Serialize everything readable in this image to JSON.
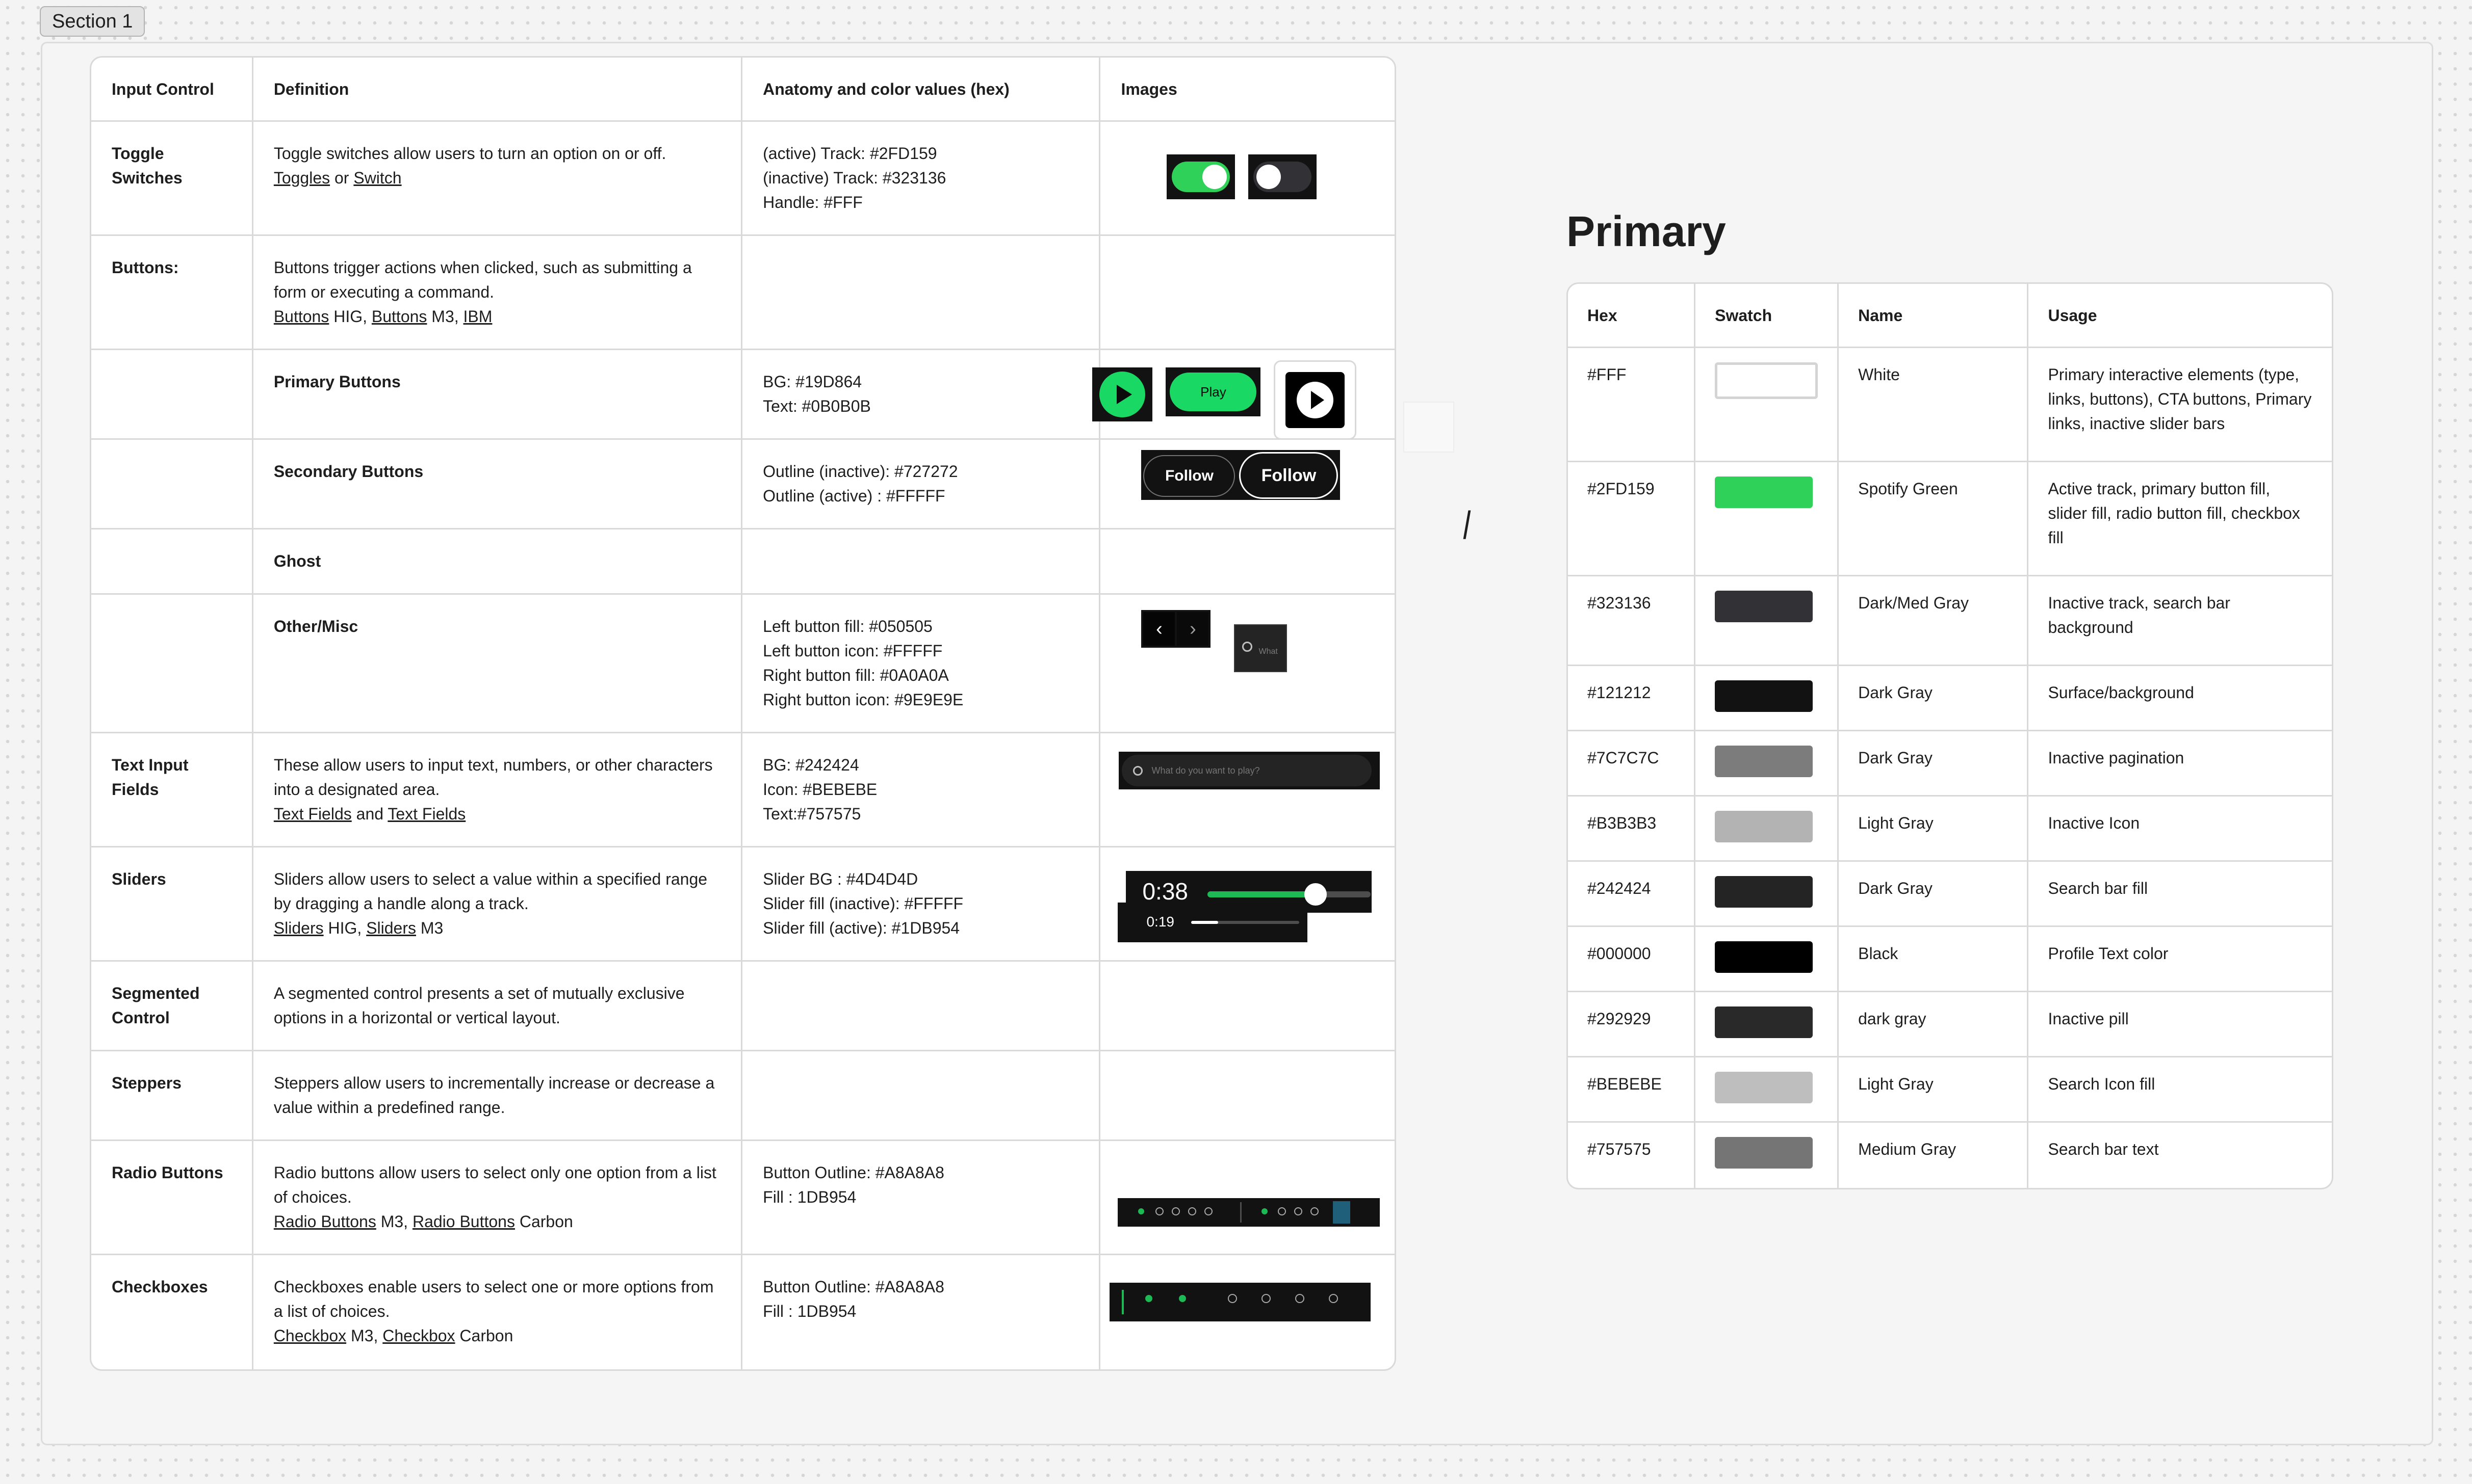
{
  "section_label": "Section 1",
  "left_table": {
    "headers": [
      "Input Control",
      "Definition",
      "Anatomy and color values (hex)",
      "Images"
    ],
    "rows": [
      {
        "control": "Toggle Switches",
        "definition": "Toggle switches allow users to turn an option on or off.",
        "links": [
          "Toggles",
          "or",
          "Switch"
        ],
        "anatomy": [
          "(active) Track: #2FD159",
          "(inactive) Track: #323136",
          "Handle: #FFF"
        ]
      },
      {
        "control": "Buttons:",
        "definition": "Buttons trigger actions when clicked, such as submitting a form or executing a command.",
        "links": [
          "Buttons",
          "HIG,",
          "Buttons",
          "M3,",
          "IBM"
        ]
      },
      {
        "sub": "Primary Buttons",
        "anatomy": [
          "BG: #19D864",
          "Text: #0B0B0B"
        ],
        "play_label": "Play"
      },
      {
        "sub": "Secondary Buttons",
        "anatomy": [
          "Outline (inactive): #727272",
          "Outline (active) : #FFFFF"
        ],
        "follow_label": "Follow"
      },
      {
        "sub": "Ghost"
      },
      {
        "sub": "Other/Misc",
        "anatomy": [
          "Left button fill: #050505",
          "Left button icon: #FFFFF",
          "Right button fill: #0A0A0A",
          "Right button icon: #9E9E9E"
        ],
        "search_hint": "What"
      },
      {
        "control": "Text Input Fields",
        "definition": "These allow users to input text, numbers, or other characters into a designated area.",
        "links": [
          "Text Fields",
          "and",
          "Text Fields"
        ],
        "anatomy": [
          "BG: #242424",
          "Icon: #BEBEBE",
          "Text:#757575"
        ],
        "placeholder": "What do you want to play?"
      },
      {
        "control": "Sliders",
        "definition": "Sliders allow users to select a value within a specified range by dragging a handle along a track.",
        "links": [
          "Sliders",
          "HIG,",
          "Sliders",
          "M3"
        ],
        "anatomy": [
          "Slider BG : #4D4D4D",
          "Slider fill (inactive): #FFFFF",
          "Slider fill (active): #1DB954"
        ],
        "time_big": "0:38",
        "time_small": "0:19"
      },
      {
        "control": "Segmented Control",
        "definition": "A segmented control presents a set of mutually exclusive options in a horizontal or vertical layout."
      },
      {
        "control": "Steppers",
        "definition": "Steppers allow users to incrementally increase or decrease a value within a predefined range."
      },
      {
        "control": "Radio Buttons",
        "definition": "Radio buttons allow users to select only one option from a list of choices.",
        "links": [
          "Radio Buttons",
          "M3,",
          "Radio Buttons",
          "Carbon"
        ],
        "anatomy": [
          "Button Outline: #A8A8A8",
          "Fill : 1DB954"
        ]
      },
      {
        "control": "Checkboxes",
        "definition": "Checkboxes enable users to select one or more options from a list of choices.",
        "links": [
          "Checkbox",
          "M3,",
          "Checkbox",
          "Carbon"
        ],
        "anatomy": [
          "Button Outline: #A8A8A8",
          "Fill : 1DB954"
        ]
      }
    ]
  },
  "primary": {
    "title": "Primary",
    "headers": [
      "Hex",
      "Swatch",
      "Name",
      "Usage"
    ],
    "rows": [
      {
        "hex": "#FFF",
        "color": "#FFFFFF",
        "name": "White",
        "usage": "Primary interactive elements (type, links, buttons), CTA buttons, Primary links, inactive slider bars"
      },
      {
        "hex": "#2FD159",
        "color": "#2FD159",
        "name": "Spotify Green",
        "usage": "Active track, primary button fill, slider fill, radio button fill, checkbox fill"
      },
      {
        "hex": "#323136",
        "color": "#323136",
        "name": "Dark/Med Gray",
        "usage": "Inactive track, search bar background"
      },
      {
        "hex": "#121212",
        "color": "#121212",
        "name": "Dark Gray",
        "usage": "Surface/background"
      },
      {
        "hex": "#7C7C7C",
        "color": "#7C7C7C",
        "name": "Dark Gray",
        "usage": "Inactive pagination"
      },
      {
        "hex": "#B3B3B3",
        "color": "#B3B3B3",
        "name": "Light Gray",
        "usage": "Inactive Icon"
      },
      {
        "hex": "#242424",
        "color": "#242424",
        "name": "Dark Gray",
        "usage": "Search bar fill"
      },
      {
        "hex": "#000000",
        "color": "#000000",
        "name": "Black",
        "usage": "Profile Text color"
      },
      {
        "hex": " #292929",
        "color": "#292929",
        "name": "dark gray",
        "usage": "Inactive pill"
      },
      {
        "hex": "#BEBEBE",
        "color": "#BEBEBE",
        "name": "Light Gray",
        "usage": "Search Icon fill"
      },
      {
        "hex": "#757575",
        "color": "#757575",
        "name": "Medium Gray",
        "usage": "Search bar text"
      }
    ]
  },
  "cursor_mark": "|",
  "slider_progress": {
    "big": 0.66,
    "small": 0.25
  }
}
